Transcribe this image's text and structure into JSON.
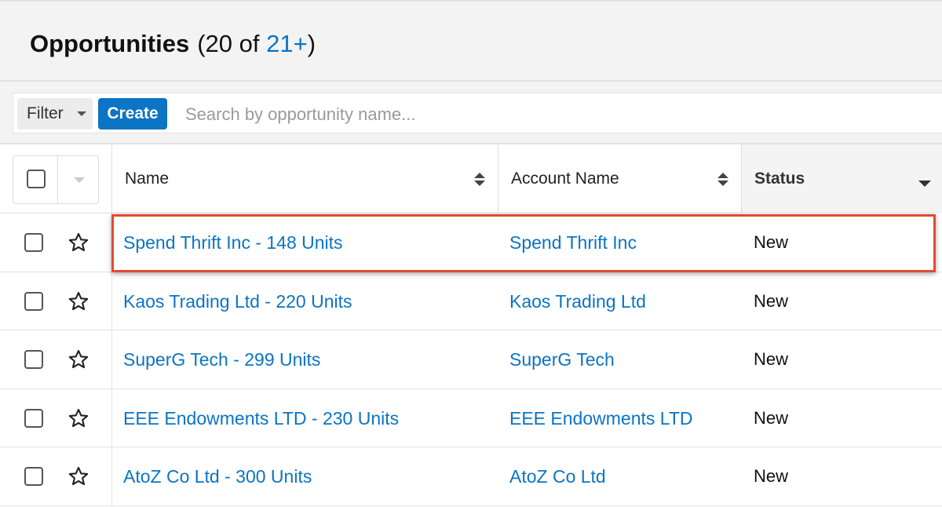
{
  "header": {
    "title": "Opportunities",
    "count_prefix": "(20 of ",
    "count_total": "21+",
    "count_suffix": ")"
  },
  "toolbar": {
    "filter_label": "Filter",
    "create_label": "Create",
    "search_placeholder": "Search by opportunity name..."
  },
  "table": {
    "columns": [
      {
        "label": "Name",
        "sort": "both"
      },
      {
        "label": "Account Name",
        "sort": "both"
      },
      {
        "label": "Status",
        "sort": "descending"
      }
    ],
    "rows": [
      {
        "name": "Spend Thrift Inc - 148 Units",
        "account": "Spend Thrift Inc",
        "status": "New"
      },
      {
        "name": "Kaos Trading Ltd - 220 Units",
        "account": "Kaos Trading Ltd",
        "status": "New"
      },
      {
        "name": "SuperG Tech - 299 Units",
        "account": "SuperG Tech",
        "status": "New"
      },
      {
        "name": "EEE Endowments LTD - 230 Units",
        "account": "EEE Endowments LTD",
        "status": "New"
      },
      {
        "name": "AtoZ Co Ltd - 300 Units",
        "account": "AtoZ Co Ltd",
        "status": "New"
      }
    ]
  },
  "colors": {
    "accent": "#0b74c4",
    "highlight": "#e04b2f"
  },
  "icons": [
    "caret-down-icon",
    "sort-icon",
    "star-icon",
    "checkbox-icon"
  ]
}
